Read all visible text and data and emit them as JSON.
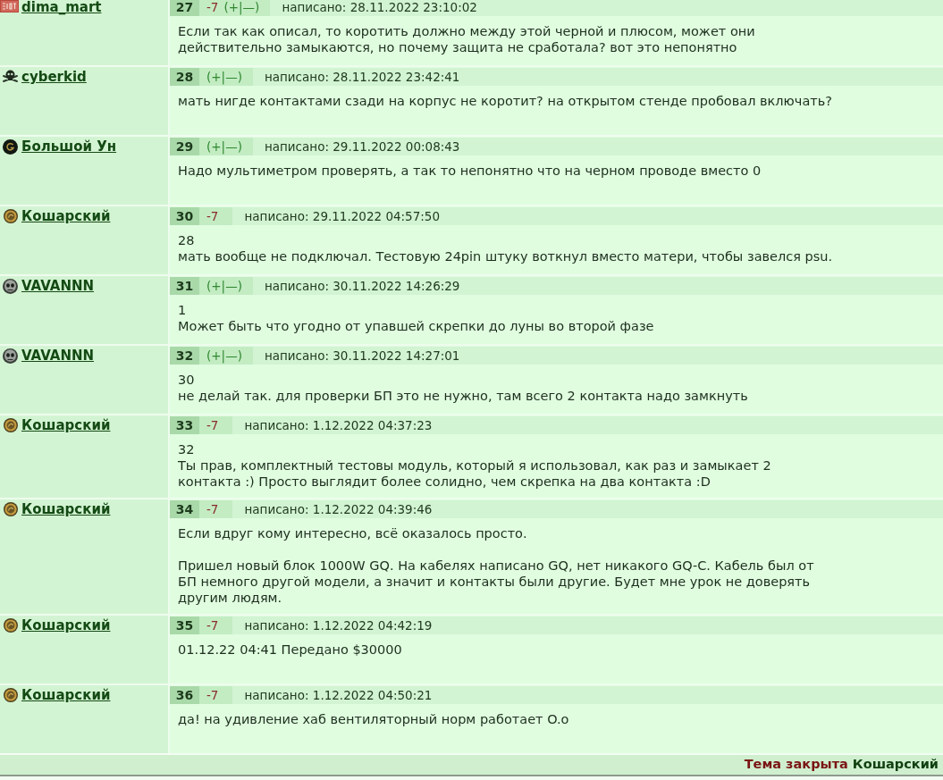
{
  "posts": [
    {
      "author": "dima_mart",
      "avatar": {
        "kind": "badge"
      },
      "number": "27",
      "rating": "-7",
      "vote": "(+|—)",
      "date": "написано: 28.11.2022 23:10:02",
      "text": "Если так как описал, то коротить должно между этой черной и плюсом, может они\nдействительно замыкаются, но почему защита не сработала? вот это непонятно"
    },
    {
      "author": "cyberkid",
      "avatar": {
        "kind": "skull-crossbones"
      },
      "number": "28",
      "vote": "(+|—)",
      "date": "написано: 28.11.2022 23:42:41",
      "text": "мать нигде контактами сзади на корпус не коротит? на открытом стенде пробовал включать?"
    },
    {
      "author": "Большой Ун",
      "avatar": {
        "kind": "g-coin"
      },
      "number": "29",
      "vote": "(+|—)",
      "date": "написано: 29.11.2022 00:08:43",
      "text": "Надо мультиметром проверять, а так то непонятно что на черном проводе вместо 0"
    },
    {
      "author": "Кошарский",
      "avatar": {
        "kind": "coin"
      },
      "number": "30",
      "rating": "-7",
      "date": "написано: 29.11.2022 04:57:50",
      "reply_to": "28",
      "text": "мать вообще не подключал. Тестовую 24pin штуку воткнул вместо матери, чтобы завелся psu."
    },
    {
      "author": "VAVANNN",
      "avatar": {
        "kind": "skull"
      },
      "number": "31",
      "vote": "(+|—)",
      "date": "написано: 30.11.2022 14:26:29",
      "reply_to": "1",
      "text": "Может быть что угодно от упавшей скрепки до луны во второй фазе"
    },
    {
      "author": "VAVANNN",
      "avatar": {
        "kind": "skull"
      },
      "number": "32",
      "vote": "(+|—)",
      "date": "написано: 30.11.2022 14:27:01",
      "reply_to": "30",
      "text": "не делай так. для проверки БП это не нужно, там всего 2 контакта надо замкнуть"
    },
    {
      "author": "Кошарский",
      "avatar": {
        "kind": "coin"
      },
      "number": "33",
      "rating": "-7",
      "date": "написано: 1.12.2022 04:37:23",
      "reply_to": "32",
      "text": "Ты прав, комплектный тестовы модуль, который я использовал, как раз и замыкает 2\nконтакта :) Просто выглядит более солидно, чем скрепка на два контакта :D"
    },
    {
      "author": "Кошарский",
      "avatar": {
        "kind": "coin"
      },
      "number": "34",
      "rating": "-7",
      "date": "написано: 1.12.2022 04:39:46",
      "text": "Если вдруг кому интересно, всё оказалось просто.\n\nПришел новый блок 1000W GQ. На кабелях написано GQ, нет никакого GQ-C. Кабель был от\nБП немного другой модели, а значит и контакты были другие. Будет мне урок не доверять\nдругим людям."
    },
    {
      "author": "Кошарский",
      "avatar": {
        "kind": "coin"
      },
      "number": "35",
      "rating": "-7",
      "date": "написано: 1.12.2022 04:42:19",
      "text": "01.12.22 04:41 Передано $30000"
    },
    {
      "author": "Кошарский",
      "avatar": {
        "kind": "coin"
      },
      "number": "36",
      "rating": "-7",
      "date": "написано: 1.12.2022 04:50:21",
      "text": "да! на удивление хаб вентиляторный норм работает O.o"
    }
  ],
  "footer": {
    "status": "Тема закрыта",
    "closed_by": "Кошарский"
  }
}
